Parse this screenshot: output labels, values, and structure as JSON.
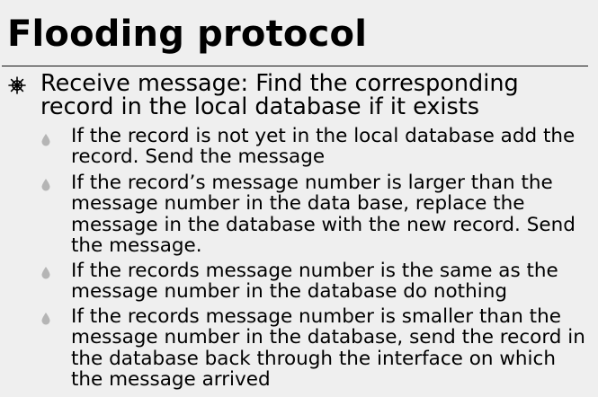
{
  "slide": {
    "title": "Flooding protocol",
    "main_icon": "ship-wheel-icon",
    "main_text": "Receive message: Find the corresponding record in the local database if it exists",
    "sub_icon": "teardrop-bullet-icon",
    "sub_items": [
      "If the record is not yet in the local database add the record. Send the message",
      "If the record’s message number is larger than the message number in the data base, replace the message in the database with the new record. Send the message.",
      "If the records message number is the same as the message number in the database do nothing",
      "If the records message number is smaller than the message number in the database, send the record in the database back through the interface on which the message arrived"
    ]
  }
}
